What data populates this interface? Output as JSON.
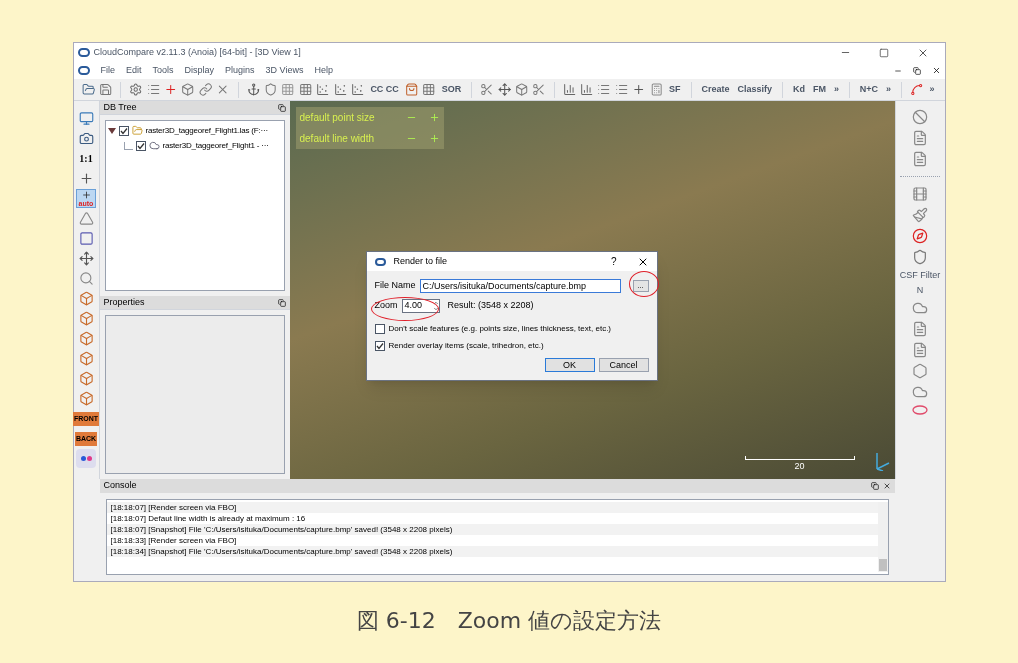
{
  "window": {
    "title": "CloudCompare v2.11.3 (Anoia) [64-bit] - [3D View 1]"
  },
  "menu": [
    "File",
    "Edit",
    "Tools",
    "Display",
    "Plugins",
    "3D Views",
    "Help"
  ],
  "toolbar": [
    {
      "kind": "folder"
    },
    {
      "kind": "save"
    },
    {
      "kind": "sep"
    },
    {
      "kind": "gear"
    },
    {
      "kind": "list"
    },
    {
      "kind": "redplus"
    },
    {
      "kind": "box"
    },
    {
      "kind": "link"
    },
    {
      "kind": "close"
    },
    {
      "kind": "sep"
    },
    {
      "kind": "hook"
    },
    {
      "kind": "shield"
    },
    {
      "kind": "dots"
    },
    {
      "kind": "grid"
    },
    {
      "kind": "scatter"
    },
    {
      "kind": "scatter"
    },
    {
      "kind": "scatter"
    },
    {
      "kind": "text",
      "label": "CC CC"
    },
    {
      "kind": "bag"
    },
    {
      "kind": "grid"
    },
    {
      "kind": "text",
      "label": "SOR"
    },
    {
      "kind": "sep"
    },
    {
      "kind": "scissors"
    },
    {
      "kind": "move"
    },
    {
      "kind": "box"
    },
    {
      "kind": "scissors"
    },
    {
      "kind": "sep"
    },
    {
      "kind": "chart"
    },
    {
      "kind": "chart"
    },
    {
      "kind": "list"
    },
    {
      "kind": "list"
    },
    {
      "kind": "plus"
    },
    {
      "kind": "calc"
    },
    {
      "kind": "text",
      "label": "SF"
    },
    {
      "kind": "sep"
    },
    {
      "kind": "text",
      "label": "Create"
    },
    {
      "kind": "text",
      "label": "Classify"
    },
    {
      "kind": "sep"
    },
    {
      "kind": "text",
      "label": "Kd"
    },
    {
      "kind": "text",
      "label": "FM"
    },
    {
      "kind": "text",
      "label": "»"
    },
    {
      "kind": "sep"
    },
    {
      "kind": "text",
      "label": "N+C"
    },
    {
      "kind": "text",
      "label": "»"
    },
    {
      "kind": "sep"
    },
    {
      "kind": "curve"
    },
    {
      "kind": "text",
      "label": "»"
    }
  ],
  "left_toolbar": [
    {
      "kind": "monitor",
      "selected": false
    },
    {
      "kind": "camera",
      "selected": false
    },
    {
      "kind": "text",
      "label": "1:1",
      "selected": false
    },
    {
      "kind": "plus",
      "selected": false
    },
    {
      "kind": "auto",
      "label": "auto",
      "selected": true
    },
    {
      "kind": "triangle",
      "selected": false
    },
    {
      "kind": "square",
      "selected": false
    },
    {
      "kind": "move",
      "selected": false
    },
    {
      "kind": "search",
      "selected": false
    },
    {
      "kind": "cube",
      "selected": false
    },
    {
      "kind": "cube",
      "selected": false
    },
    {
      "kind": "cube",
      "selected": false
    },
    {
      "kind": "cube",
      "selected": false
    },
    {
      "kind": "cube",
      "selected": false
    },
    {
      "kind": "cube",
      "selected": false
    },
    {
      "kind": "face",
      "label": "FRONT",
      "selected": false
    },
    {
      "kind": "face",
      "label": "BACK",
      "selected": false
    },
    {
      "kind": "dots",
      "selected": false
    }
  ],
  "db_tree": {
    "title": "DB Tree",
    "items": [
      {
        "label": "raster3D_taggeoref_Flight1.las (F:···",
        "checked": true,
        "expanded": true,
        "children": [
          {
            "label": "raster3D_taggeoref_Flight1 - ···",
            "checked": true
          }
        ]
      }
    ]
  },
  "properties": {
    "title": "Properties"
  },
  "view": {
    "overlay": [
      "default point size",
      "default line width"
    ],
    "scale_label": "20"
  },
  "dialog": {
    "title": "Render to file",
    "help": "?",
    "file_name_label": "File Name",
    "file_name": "C:/Users/isituka/Documents/capture.bmp",
    "browse": "...",
    "zoom_label": "Zoom",
    "zoom": "4.00",
    "result": "Result: (3548 x 2208)",
    "options": [
      {
        "label": "Don't scale features (e.g. points size, lines thickness, text, etc.)",
        "checked": false
      },
      {
        "label": "Render overlay items (scale, trihedron, etc.)",
        "checked": true
      }
    ],
    "buttons": [
      "OK",
      "Cancel"
    ]
  },
  "right_toolbar": [
    {
      "kind": "ban"
    },
    {
      "kind": "doc"
    },
    {
      "kind": "doc"
    },
    {
      "kind": "sep"
    },
    {
      "kind": "film"
    },
    {
      "kind": "brush"
    },
    {
      "kind": "compass"
    },
    {
      "kind": "shield"
    },
    {
      "kind": "text",
      "label": "CSF Filter"
    },
    {
      "kind": "text",
      "label": "N"
    },
    {
      "kind": "cloud"
    },
    {
      "kind": "doc"
    },
    {
      "kind": "doc"
    },
    {
      "kind": "hexagon"
    },
    {
      "kind": "cloud"
    },
    {
      "kind": "ellipse"
    }
  ],
  "console": {
    "title": "Console",
    "lines": [
      "[18:18:07] [Render screen via FBO]",
      "[18:18:07] Defaut line width is already at maximum : 16",
      "[18:18:07] [Snapshot] File 'C:/Users/isituka/Documents/capture.bmp' saved! (3548 x 2208 pixels)",
      "[18:18:33] [Render screen via FBO]",
      "[18:18:34] [Snapshot] File 'C:/Users/isituka/Documents/capture.bmp' saved! (3548 x 2208 pixels)"
    ]
  },
  "caption": "図 6-12　Zoom 値の設定方法"
}
